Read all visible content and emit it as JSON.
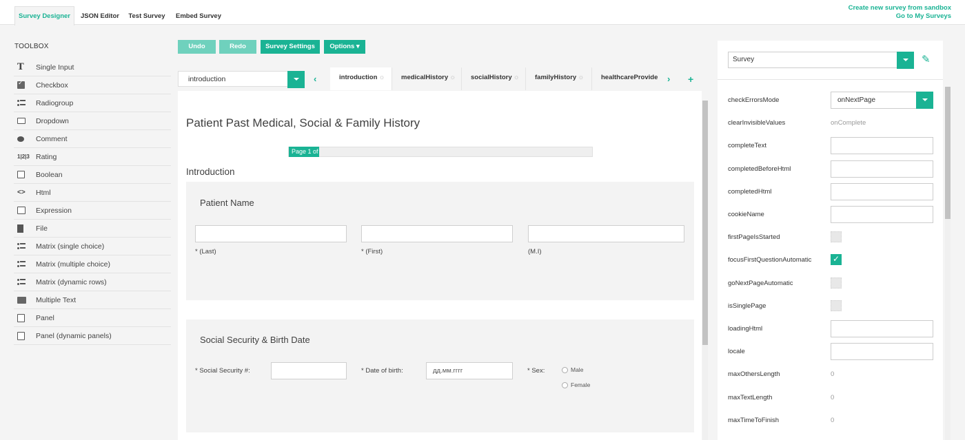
{
  "top_tabs": [
    "Survey Designer",
    "JSON Editor",
    "Test Survey",
    "Embed Survey"
  ],
  "top_links": [
    "Create new survey from sandbox",
    "Go to My Surveys"
  ],
  "toolbox": {
    "title": "TOOLBOX",
    "items": [
      {
        "label": "Single Input",
        "icon": "text-input-icon"
      },
      {
        "label": "Checkbox",
        "icon": "checkbox-icon"
      },
      {
        "label": "Radiogroup",
        "icon": "radiogroup-icon"
      },
      {
        "label": "Dropdown",
        "icon": "dropdown-icon"
      },
      {
        "label": "Comment",
        "icon": "comment-icon"
      },
      {
        "label": "Rating",
        "icon": "rating-icon"
      },
      {
        "label": "Boolean",
        "icon": "boolean-icon"
      },
      {
        "label": "Html",
        "icon": "html-icon"
      },
      {
        "label": "Expression",
        "icon": "expression-icon"
      },
      {
        "label": "File",
        "icon": "file-icon"
      },
      {
        "label": "Matrix (single choice)",
        "icon": "matrix-icon"
      },
      {
        "label": "Matrix (multiple choice)",
        "icon": "matrix-multiple-icon"
      },
      {
        "label": "Matrix (dynamic rows)",
        "icon": "matrix-dynamic-icon"
      },
      {
        "label": "Multiple Text",
        "icon": "multiple-text-icon"
      },
      {
        "label": "Panel",
        "icon": "panel-icon"
      },
      {
        "label": "Panel (dynamic panels)",
        "icon": "panel-dynamic-icon"
      }
    ]
  },
  "actions": {
    "undo": "Undo",
    "redo": "Redo",
    "settings": "Survey Settings",
    "options": "Options ▾"
  },
  "page_selector": {
    "value": "introduction"
  },
  "page_tabs": [
    "introduction",
    "medicalHistory",
    "socialHistory",
    "familyHistory",
    "healthcareProvider"
  ],
  "survey": {
    "title": "Patient Past Medical, Social & Family History",
    "progress_text": "Page 1 of",
    "progress_value": 0.1,
    "page_title": "Introduction",
    "panel1": {
      "title": "Patient Name",
      "labels": [
        "* (Last)",
        "* (First)",
        "(M.I)"
      ]
    },
    "panel2": {
      "title": "Social Security & Birth Date",
      "ssn_label": "* Social Security #:",
      "dob_label": "* Date of birth:",
      "dob_placeholder": "дд.мм.гггг",
      "sex_label": "* Sex:",
      "sex_options": [
        "Male",
        "Female"
      ]
    }
  },
  "properties": {
    "object_select": "Survey",
    "rows": [
      {
        "name": "checkErrorsMode",
        "type": "select",
        "value": "onNextPage"
      },
      {
        "name": "clearInvisibleValues",
        "type": "value",
        "value": "onComplete"
      },
      {
        "name": "completeText",
        "type": "text",
        "value": ""
      },
      {
        "name": "completedBeforeHtml",
        "type": "text",
        "value": ""
      },
      {
        "name": "completedHtml",
        "type": "text",
        "value": ""
      },
      {
        "name": "cookieName",
        "type": "text",
        "value": ""
      },
      {
        "name": "firstPageIsStarted",
        "type": "check",
        "value": false
      },
      {
        "name": "focusFirstQuestionAutomatic",
        "type": "check",
        "value": true
      },
      {
        "name": "goNextPageAutomatic",
        "type": "check",
        "value": false
      },
      {
        "name": "isSinglePage",
        "type": "check",
        "value": false
      },
      {
        "name": "loadingHtml",
        "type": "text",
        "value": ""
      },
      {
        "name": "locale",
        "type": "text",
        "value": ""
      },
      {
        "name": "maxOthersLength",
        "type": "value",
        "value": "0"
      },
      {
        "name": "maxTextLength",
        "type": "value",
        "value": "0"
      },
      {
        "name": "maxTimeToFinish",
        "type": "value",
        "value": "0"
      }
    ]
  },
  "colors": {
    "accent": "#1ab394",
    "accent_disabled": "#6fd1bd"
  }
}
